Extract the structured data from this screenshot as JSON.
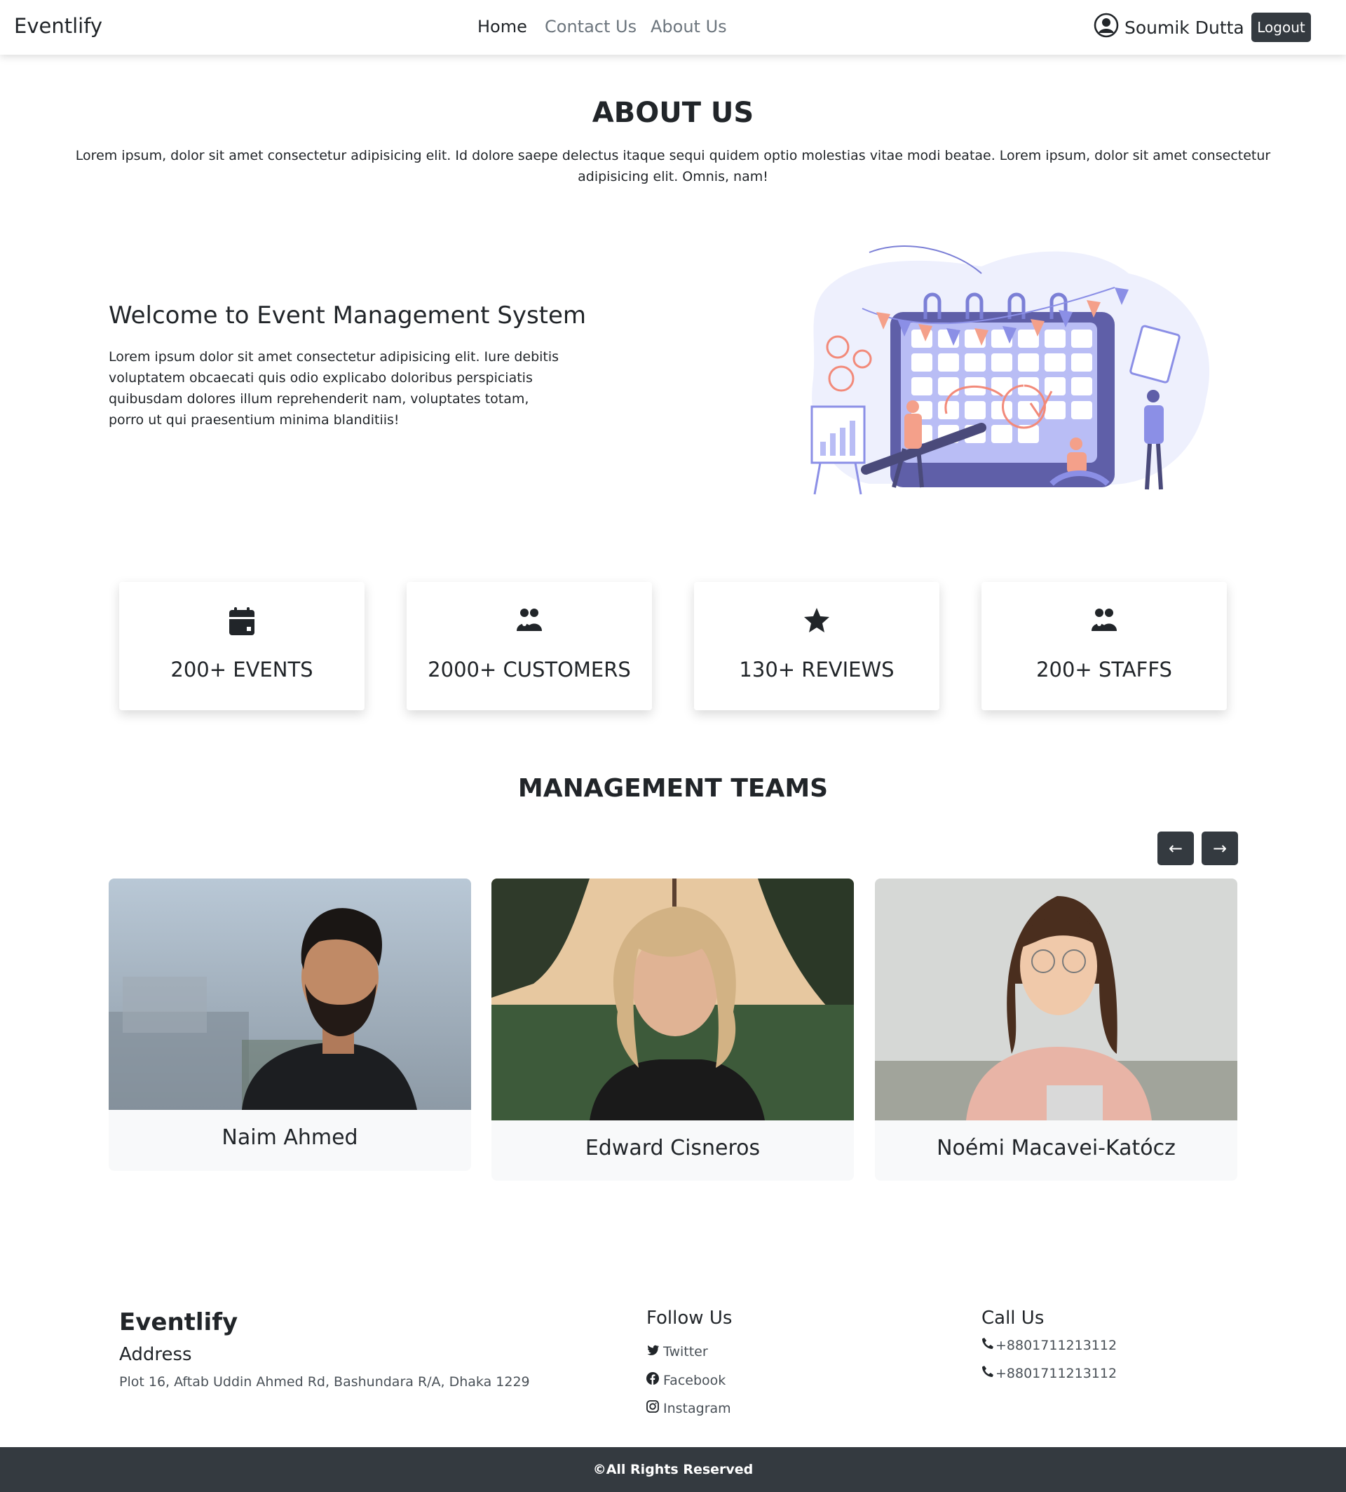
{
  "nav": {
    "brand": "Eventlify",
    "links": [
      "Home",
      "Contact Us",
      "About Us"
    ],
    "user_name": "Soumik Dutta",
    "logout_label": "Logout"
  },
  "about": {
    "title": "ABOUT US",
    "text": "Lorem ipsum, dolor sit amet consectetur adipisicing elit. Id dolore saepe delectus itaque sequi quidem optio molestias vitae modi beatae. Lorem ipsum, dolor sit amet consectetur adipisicing elit. Omnis, nam!"
  },
  "welcome": {
    "title": "Welcome to Event Management System",
    "text": "Lorem ipsum dolor sit amet consectetur adipisicing elit. Iure debitis voluptatem obcaecati quis odio explicabo doloribus perspiciatis quibusdam dolores illum reprehenderit nam, voluptates totam, porro ut qui praesentium minima blanditiis!"
  },
  "stats": [
    {
      "icon": "calendar-icon",
      "label": "200+ EVENTS"
    },
    {
      "icon": "people-icon",
      "label": "2000+ CUSTOMERS"
    },
    {
      "icon": "star-icon",
      "label": "130+ REVIEWS"
    },
    {
      "icon": "people-icon",
      "label": "200+ STAFFS"
    }
  ],
  "teams": {
    "title": "MANAGEMENT TEAMS",
    "prev_label": "←",
    "next_label": "→",
    "members": [
      {
        "name": "Naim Ahmed"
      },
      {
        "name": "Edward Cisneros"
      },
      {
        "name": "Noémi Macavei-Katócz"
      }
    ]
  },
  "footer": {
    "brand": "Eventlify",
    "address_heading": "Address",
    "address": "Plot 16, Aftab Uddin Ahmed Rd, Bashundara R/A, Dhaka 1229",
    "follow_heading": "Follow Us",
    "social": [
      "Twitter",
      "Facebook",
      "Instagram"
    ],
    "call_heading": "Call Us",
    "phones": [
      "+8801711213112",
      "+8801711213112"
    ],
    "copyright": "©All Rights Reserved"
  },
  "colors": {
    "dark": "#343a40",
    "text": "#212529",
    "muted": "#6c757d",
    "card_bg": "#f8f9fa",
    "accent_purple": "#8b8fe6",
    "accent_salmon": "#f4a08a"
  }
}
